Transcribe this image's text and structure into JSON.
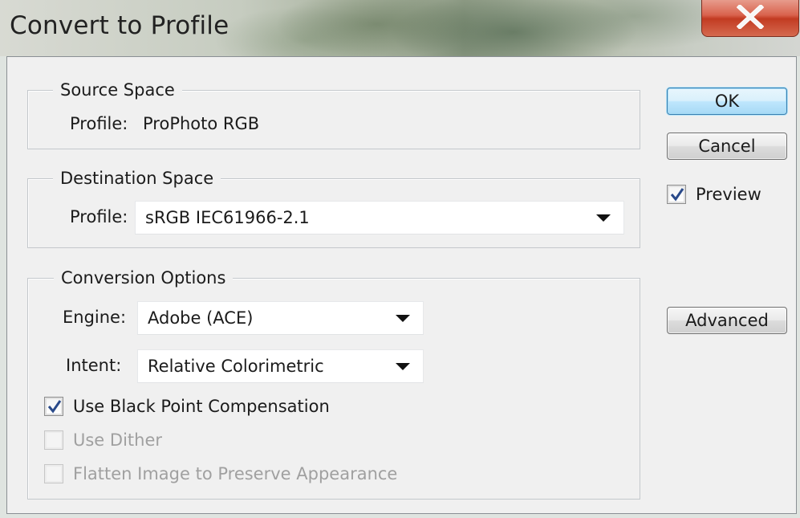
{
  "window": {
    "title": "Convert to Profile"
  },
  "source_space": {
    "legend": "Source Space",
    "profile_label": "Profile:",
    "profile_value": "ProPhoto RGB"
  },
  "destination_space": {
    "legend": "Destination Space",
    "profile_label": "Profile:",
    "profile_selected": "sRGB IEC61966-2.1"
  },
  "conversion_options": {
    "legend": "Conversion Options",
    "engine_label": "Engine:",
    "engine_selected": "Adobe (ACE)",
    "intent_label": "Intent:",
    "intent_selected": "Relative Colorimetric",
    "black_point": {
      "label": "Use Black Point Compensation",
      "checked": true,
      "enabled": true
    },
    "dither": {
      "label": "Use Dither",
      "checked": false,
      "enabled": false
    },
    "flatten": {
      "label": "Flatten Image to Preserve Appearance",
      "checked": false,
      "enabled": false
    }
  },
  "buttons": {
    "ok": "OK",
    "cancel": "Cancel",
    "advanced": "Advanced"
  },
  "preview": {
    "label": "Preview",
    "checked": true
  },
  "icons": {
    "close": "close-icon",
    "checkmark": "checkmark-icon",
    "dropdown": "chevron-down-icon"
  },
  "colors": {
    "close_button": "#c23b22",
    "default_button_border": "#3c7fb1",
    "checkmark": "#2a4a8a",
    "disabled_text": "#a0a0a0"
  }
}
